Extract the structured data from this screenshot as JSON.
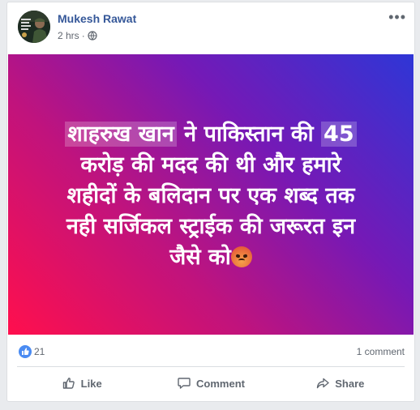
{
  "post": {
    "author": "Mukesh Rawat",
    "time": "2 hrs",
    "time_separator": "·",
    "audience_icon": "globe-icon",
    "more_icon": "more-options-icon",
    "more_glyph": "•••",
    "content": {
      "line1_highlight_a": "शाहरुख खान",
      "line1_middle": " ने पाकिस्तान की ",
      "line1_highlight_b": "45",
      "line2": "करोड़ की मदद की थी और हमारे",
      "line3": "शहीदों के बलिदान पर एक शब्द तक",
      "line4": "नही सर्जिकल स्ट्राईक की जरूरत इन",
      "line5": "जैसे को",
      "emoji": "angry-face-emoji"
    },
    "background_gradient": [
      "#ff0f4d",
      "#c0137d",
      "#7519b6",
      "#2e36d6"
    ]
  },
  "stats": {
    "likes": "21",
    "comments": "1 comment"
  },
  "actions": {
    "like": "Like",
    "comment": "Comment",
    "share": "Share"
  },
  "colors": {
    "author": "#365899",
    "meta": "#616770",
    "like_badge": "#4a8bf2"
  }
}
